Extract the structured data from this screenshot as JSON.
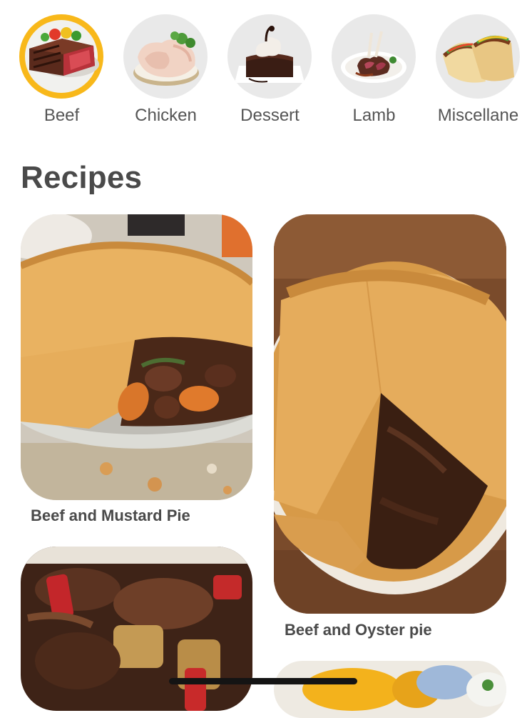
{
  "categories": [
    {
      "label": "Beef",
      "icon": "beef-steak-icon",
      "selected": true
    },
    {
      "label": "Chicken",
      "icon": "raw-chicken-icon",
      "selected": false
    },
    {
      "label": "Dessert",
      "icon": "chocolate-cake-icon",
      "selected": false
    },
    {
      "label": "Lamb",
      "icon": "lamb-chops-icon",
      "selected": false
    },
    {
      "label": "Miscellane",
      "icon": "tacos-icon",
      "selected": false
    }
  ],
  "section": {
    "title": "Recipes"
  },
  "recipes": [
    {
      "name": "Beef and Mustard Pie",
      "image": "beef-mustard-pie-photo"
    },
    {
      "name": "Beef and Oyster pie",
      "image": "beef-oyster-pie-photo"
    },
    {
      "name": "",
      "image": "beef-stew-photo"
    },
    {
      "name": "",
      "image": "mango-dish-photo"
    }
  ],
  "colors": {
    "accent": "#f8b81a",
    "thumb_bg": "#e9e9e9"
  }
}
